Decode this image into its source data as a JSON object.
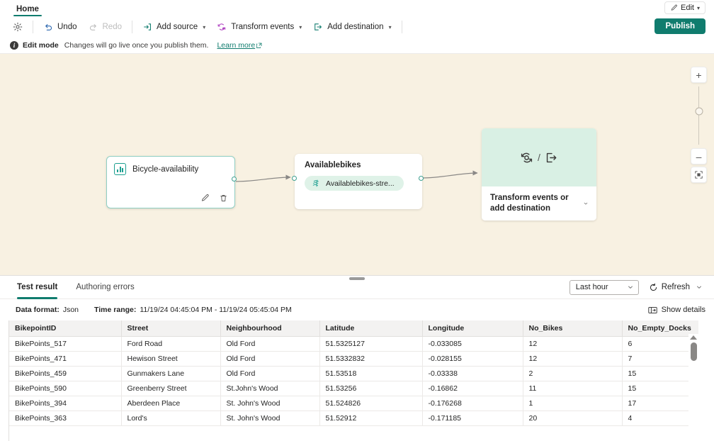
{
  "tabstrip": {
    "home_tab": "Home",
    "edit_button": "Edit"
  },
  "toolbar": {
    "settings_icon": "gear-icon",
    "undo": "Undo",
    "redo": "Redo",
    "add_source": "Add source",
    "transform_events": "Transform events",
    "add_destination": "Add destination",
    "publish": "Publish"
  },
  "banner": {
    "mode": "Edit mode",
    "message": "Changes will go live once you publish them.",
    "link": "Learn more"
  },
  "canvas": {
    "source_node": {
      "title": "Bicycle-availability",
      "edit_icon": "pencil-icon",
      "delete_icon": "trash-icon"
    },
    "stream_node": {
      "title": "Availablebikes",
      "pill_label": "Availablebikes-stre...",
      "pill_icon": "stream-icon"
    },
    "placeholder_node": {
      "transform_icon": "transform-events-icon",
      "separator": "/",
      "destination_icon": "add-destination-icon",
      "label": "Transform events or add destination"
    },
    "zoom_controls": {
      "zoom_in": "+",
      "zoom_out": "–",
      "fit_to_screen": "fit-to-screen-icon"
    }
  },
  "panel": {
    "tabs": [
      {
        "label": "Test result",
        "active": true
      },
      {
        "label": "Authoring errors",
        "active": false
      }
    ],
    "time_filter": "Last hour",
    "refresh": "Refresh",
    "data_format_label": "Data format:",
    "data_format_value": "Json",
    "time_range_label": "Time range:",
    "time_range_value": "11/19/24 04:45:04 PM  -  11/19/24 05:45:04 PM",
    "show_details": "Show details"
  },
  "table": {
    "columns": [
      "BikepointID",
      "Street",
      "Neighbourhood",
      "Latitude",
      "Longitude",
      "No_Bikes",
      "No_Empty_Docks"
    ],
    "rows": [
      [
        "BikePoints_517",
        "Ford Road",
        "Old Ford",
        "51.5325127",
        "-0.033085",
        "12",
        "6"
      ],
      [
        "BikePoints_471",
        "Hewison Street",
        "Old Ford",
        "51.5332832",
        "-0.028155",
        "12",
        "7"
      ],
      [
        "BikePoints_459",
        "Gunmakers Lane",
        "Old Ford",
        "51.53518",
        "-0.03338",
        "2",
        "15"
      ],
      [
        "BikePoints_590",
        "Greenberry Street",
        "St.John's Wood",
        "51.53256",
        "-0.16862",
        "11",
        "15"
      ],
      [
        "BikePoints_394",
        "Aberdeen Place",
        "St. John's Wood",
        "51.524826",
        "-0.176268",
        "1",
        "17"
      ],
      [
        "BikePoints_363",
        "Lord's",
        "St. John's Wood",
        "51.52912",
        "-0.171185",
        "20",
        "4"
      ]
    ]
  },
  "colors": {
    "accent_teal": "#107c6e",
    "canvas_bg": "#f8f1e2",
    "node_border": "#8fcfc3",
    "pill_bg": "#dff2e8",
    "placeholder_bg": "#d9f0e4"
  }
}
